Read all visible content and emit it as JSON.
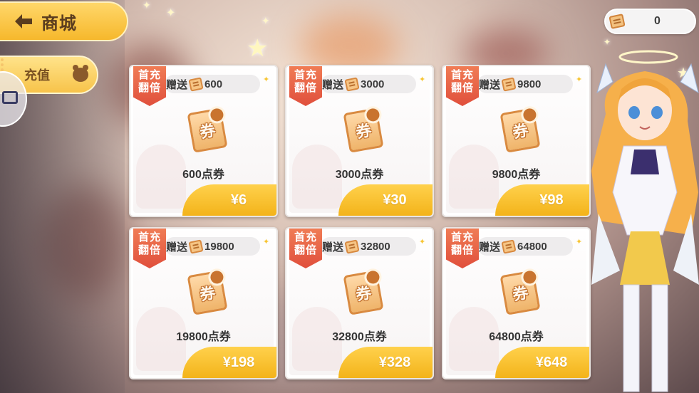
{
  "header": {
    "title": "商城"
  },
  "sidebar": {
    "tabs": [
      {
        "label": "充值"
      }
    ]
  },
  "currency": {
    "value": "0",
    "icon": "coupon-icon"
  },
  "products": [
    {
      "badge_line1": "首充",
      "badge_line2": "翻倍",
      "bonus_label": "赠送",
      "bonus_amount": "600",
      "name": "600点券",
      "price": "¥6"
    },
    {
      "badge_line1": "首充",
      "badge_line2": "翻倍",
      "bonus_label": "赠送",
      "bonus_amount": "3000",
      "name": "3000点券",
      "price": "¥30"
    },
    {
      "badge_line1": "首充",
      "badge_line2": "翻倍",
      "bonus_label": "赠送",
      "bonus_amount": "9800",
      "name": "9800点券",
      "price": "¥98"
    },
    {
      "badge_line1": "首充",
      "badge_line2": "翻倍",
      "bonus_label": "赠送",
      "bonus_amount": "19800",
      "name": "19800点券",
      "price": "¥198"
    },
    {
      "badge_line1": "首充",
      "badge_line2": "翻倍",
      "bonus_label": "赠送",
      "bonus_amount": "32800",
      "name": "32800点券",
      "price": "¥328"
    },
    {
      "badge_line1": "首充",
      "badge_line2": "翻倍",
      "bonus_label": "赠送",
      "bonus_amount": "64800",
      "name": "64800点券",
      "price": "¥648"
    }
  ],
  "coupon_glyph": "券",
  "colors": {
    "accent": "#f6b82c",
    "badge": "#e35a3f",
    "price_button": "#f5b722"
  }
}
